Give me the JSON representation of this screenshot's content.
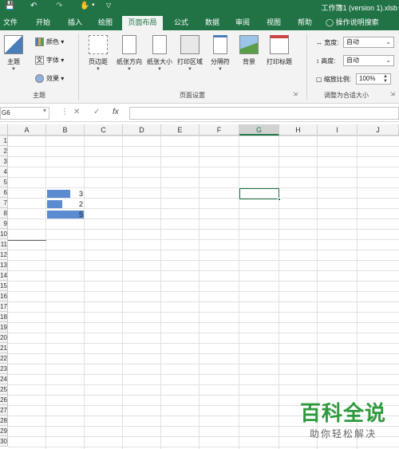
{
  "window": {
    "title": "工作簿1 (version 1).xlsb"
  },
  "tabs": [
    {
      "label": "文件",
      "active": false
    },
    {
      "label": "开始",
      "active": false
    },
    {
      "label": "插入",
      "active": false
    },
    {
      "label": "绘图",
      "active": false
    },
    {
      "label": "页面布局",
      "active": true
    },
    {
      "label": "公式",
      "active": false
    },
    {
      "label": "数据",
      "active": false
    },
    {
      "label": "审阅",
      "active": false
    },
    {
      "label": "视图",
      "active": false
    },
    {
      "label": "帮助",
      "active": false
    }
  ],
  "tell_me": "操作说明搜索",
  "ribbon": {
    "theme_group": {
      "label": "主题",
      "theme": "主题",
      "colors": "颜色",
      "fonts": "字体",
      "effects": "效果"
    },
    "page_setup_group": {
      "label": "页面设置",
      "margins": "页边距",
      "orientation": "纸张方向",
      "size": "纸张大小",
      "print_area": "打印区域",
      "breaks": "分隔符",
      "background": "背景",
      "print_titles": "打印标题"
    },
    "scale_group": {
      "label": "调整为合适大小",
      "width_label": "宽度:",
      "width_value": "自动",
      "height_label": "高度:",
      "height_value": "自动",
      "scale_label": "缩放比例:",
      "scale_value": "100%"
    }
  },
  "formula_bar": {
    "name_box": "G6",
    "fx": "fx",
    "formula": ""
  },
  "columns": [
    "A",
    "B",
    "C",
    "D",
    "E",
    "F",
    "G",
    "H",
    "I",
    "J"
  ],
  "selected_column": "G",
  "rows": [
    "1",
    "2",
    "3",
    "4",
    "5",
    "6",
    "7",
    "8",
    "9",
    "10",
    "11",
    "12",
    "13",
    "14",
    "15",
    "16",
    "17",
    "18",
    "19",
    "20",
    "21",
    "22",
    "23",
    "24",
    "25",
    "26",
    "27",
    "28",
    "29",
    "30"
  ],
  "cells": {
    "b6": "3",
    "b7": "2",
    "b8": "5"
  },
  "watermark": {
    "line1": "百科全说",
    "line2": "助你轻松解决"
  },
  "colors": {
    "excel_green": "#217346",
    "data_bar": "#5b8bd0"
  }
}
